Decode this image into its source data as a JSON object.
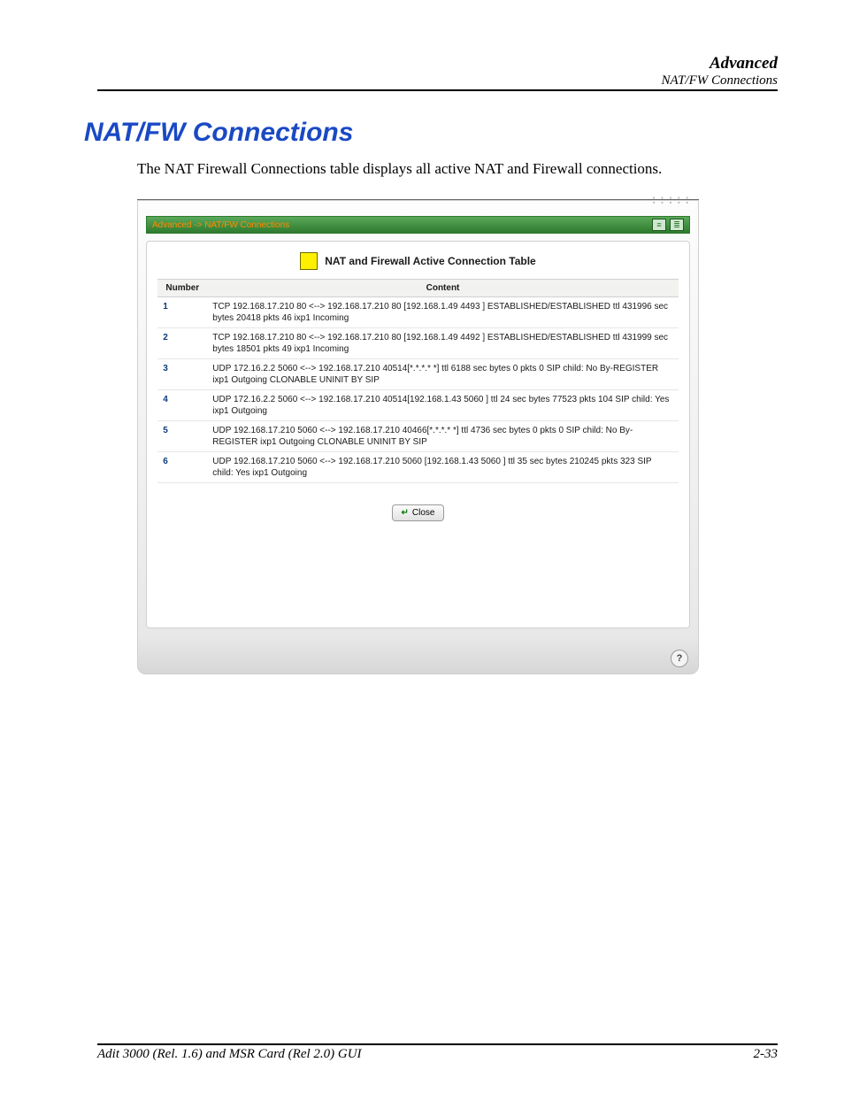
{
  "header": {
    "title": "Advanced",
    "subtitle": "NAT/FW Connections"
  },
  "section": {
    "title": "NAT/FW Connections",
    "intro": "The NAT Firewall Connections table displays all active NAT and Firewall connections."
  },
  "screenshot": {
    "breadcrumb": "Advanced -> NAT/FW Connections",
    "panel_title": "NAT and Firewall Active Connection Table",
    "columns": {
      "number": "Number",
      "content": "Content"
    },
    "rows": [
      {
        "n": "1",
        "c": "TCP 192.168.17.210 80 <--> 192.168.17.210 80 [192.168.1.49 4493 ] ESTABLISHED/ESTABLISHED ttl 431996 sec bytes 20418 pkts 46 ixp1 Incoming"
      },
      {
        "n": "2",
        "c": "TCP 192.168.17.210 80 <--> 192.168.17.210 80 [192.168.1.49 4492 ] ESTABLISHED/ESTABLISHED ttl 431999 sec bytes 18501 pkts 49 ixp1 Incoming"
      },
      {
        "n": "3",
        "c": "UDP 172.16.2.2 5060 <--> 192.168.17.210 40514[*.*.*.* *] ttl 6188 sec bytes 0 pkts 0 SIP child: No By-REGISTER ixp1 Outgoing CLONABLE UNINIT BY SIP"
      },
      {
        "n": "4",
        "c": "UDP 172.16.2.2 5060 <--> 192.168.17.210 40514[192.168.1.43 5060 ] ttl 24 sec bytes 77523 pkts 104 SIP child: Yes ixp1 Outgoing"
      },
      {
        "n": "5",
        "c": "UDP 192.168.17.210 5060 <--> 192.168.17.210 40466[*.*.*.* *] ttl 4736 sec bytes 0 pkts 0 SIP child: No By-REGISTER ixp1 Outgoing CLONABLE UNINIT BY SIP"
      },
      {
        "n": "6",
        "c": "UDP 192.168.17.210 5060 <--> 192.168.17.210 5060 [192.168.1.43 5060 ] ttl 35 sec bytes 210245 pkts 323 SIP child: Yes ixp1 Outgoing"
      }
    ],
    "close_label": "Close",
    "help_label": "?"
  },
  "footer": {
    "left": "Adit 3000 (Rel. 1.6) and MSR Card (Rel 2.0) GUI",
    "right": "2-33"
  }
}
